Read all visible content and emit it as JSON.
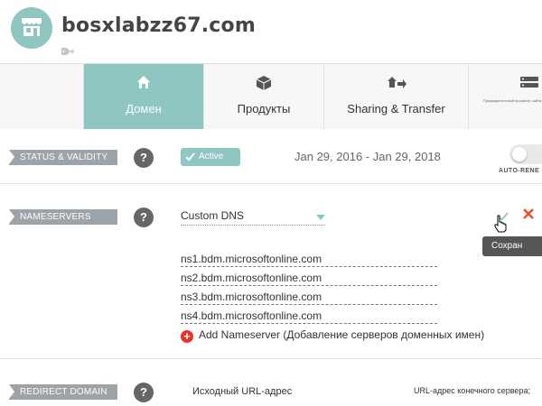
{
  "header": {
    "domain": "bosxlabzz67.com",
    "avatar_icon": "store-icon",
    "tag_icon": "tag-add-icon"
  },
  "tabs": [
    {
      "label": "Домен",
      "icon": "home-icon",
      "active": true
    },
    {
      "label": "Продукты",
      "icon": "box-icon",
      "active": false
    },
    {
      "label": "Sharing & Transfer",
      "icon": "share-transfer-icon",
      "active": false
    },
    {
      "label": "Предварительный просмотр сайта",
      "icon": "server-icon",
      "active": false
    }
  ],
  "status": {
    "label": "STATUS & VALIDITY",
    "badge": "Active",
    "date_range": "Jan 29, 2016 - Jan 29, 2018",
    "auto_renew_label": "AUTO-RENE",
    "auto_renew_on": false
  },
  "nameservers": {
    "label": "NAMESERVERS",
    "selected": "Custom DNS",
    "servers": [
      "ns1.bdm.microsoftonline.com",
      "ns2.bdm.microsoftonline.com",
      "ns3.bdm.microsoftonline.com",
      "ns4.bdm.microsoftonline.com"
    ],
    "add_label": "Add Nameserver (Добавление серверов доменных имен)",
    "save_tooltip": "Сохран"
  },
  "redirect": {
    "label": "REDIRECT DOMAIN",
    "source_label": "Исходный URL-адрес",
    "target_label": "URL-адрес конечного сервера;"
  },
  "help_glyph": "?",
  "colors": {
    "accent": "#8fc6c2",
    "label_bg": "#9ea3a7",
    "cancel": "#e8502b",
    "add": "#e8322b"
  }
}
